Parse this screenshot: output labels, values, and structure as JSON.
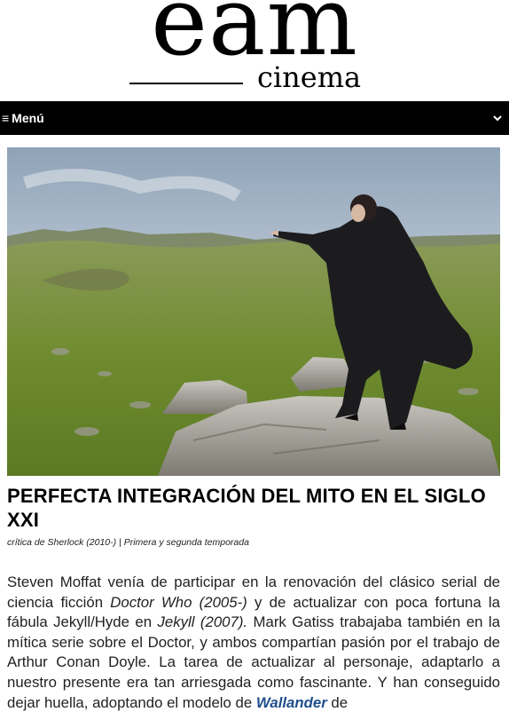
{
  "header": {
    "logo_main": "eam",
    "logo_sub": "cinema"
  },
  "menu": {
    "label": "Menú",
    "icon": "hamburger-icon",
    "toggle_icon": "chevron-down-icon"
  },
  "article": {
    "hero_image": "man-in-black-coat-pointing-on-rocky-moorland",
    "title": "PERFECTA INTEGRACIÓN DEL MITO EN EL SIGLO XXI",
    "meta": "crítica de Sherlock (2010-) | Primera y segunda temporada",
    "body": {
      "p1_a": "Steven Moffat venía de participar en la renovación del clásico serial de ciencia ficción ",
      "p1_em1": "Doctor Who (2005-)",
      "p1_b": " y de actualizar con poca fortuna la fábula Jekyll/Hyde en ",
      "p1_em2": "Jekyll (2007).",
      "p1_c": " Mark Gatiss trabajaba también en la mítica serie sobre el Doctor, y ambos compartían pasión por el trabajo de Arthur Conan Doyle. La tarea de actualizar al personaje, adaptarlo a nuestro presente era tan arriesgada como fascinante. Y han conseguido dejar huella, adoptando el modelo de ",
      "p1_link": "Wallander",
      "p1_d": " de"
    }
  }
}
